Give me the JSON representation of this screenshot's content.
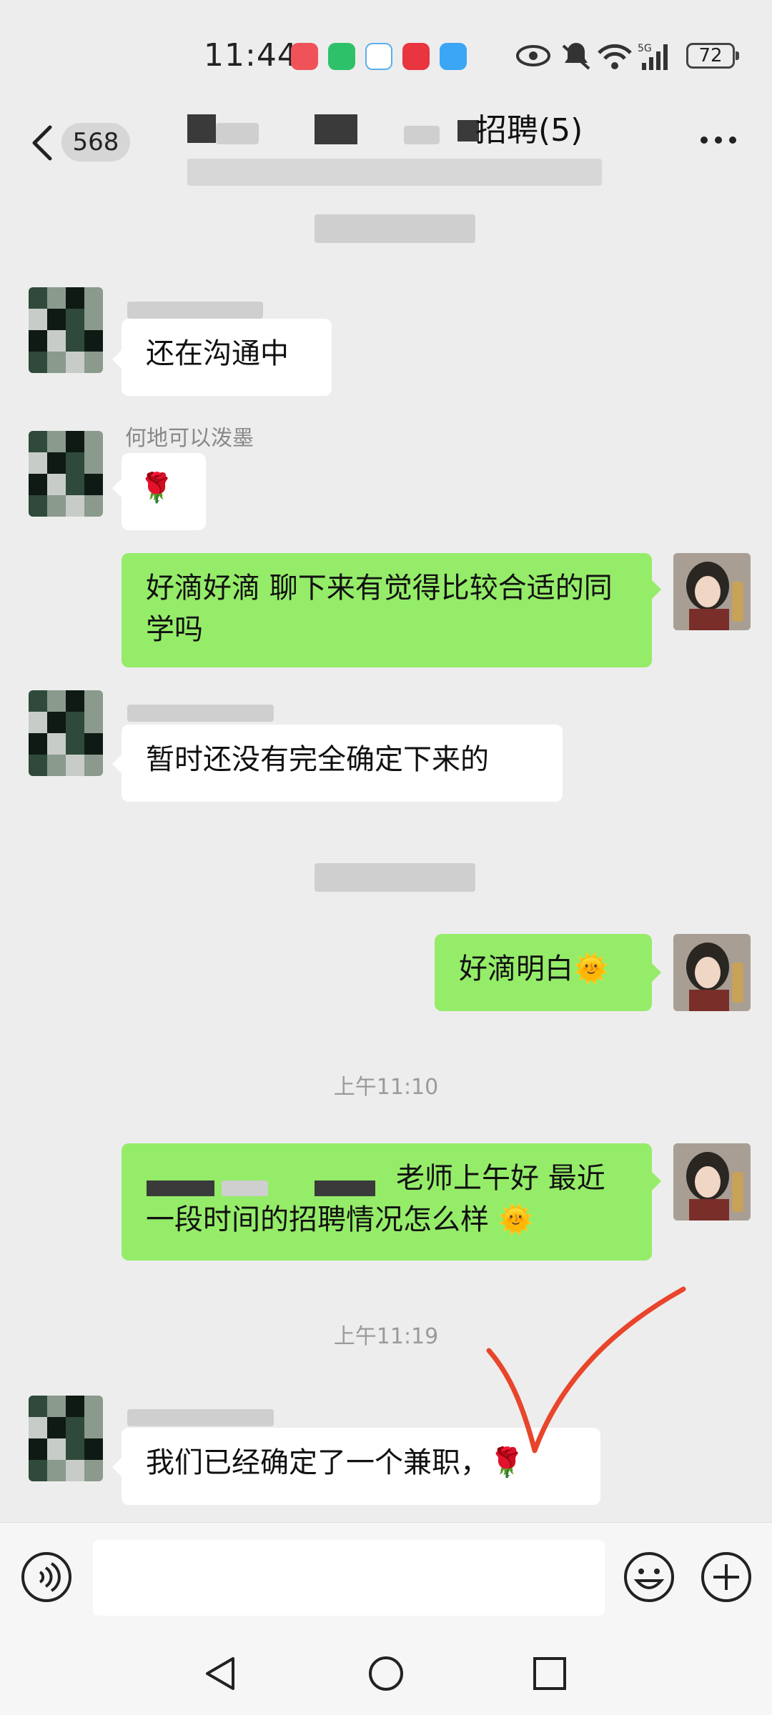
{
  "status_bar": {
    "time": "11:44",
    "network": "5G",
    "battery": "72"
  },
  "header": {
    "unread_count": "568",
    "title": "招聘(5)"
  },
  "messages": {
    "m1": "还在沟通中",
    "m2_sender": "何地可以泼墨",
    "m2": "🌹",
    "m3": "好滴好滴 聊下来有觉得比较合适的同学吗",
    "m4": "暂时还没有完全确定下来的",
    "m5": "好滴明白🌞",
    "ts1": "上午11:10",
    "m6": "老师上午好 最近一段时间的招聘情况怎么样 🌞",
    "ts2": "上午11:19",
    "m7": "我们已经确定了一个兼职，🌹"
  },
  "input": {
    "value": ""
  },
  "colors": {
    "bubble_out": "#95ec69",
    "bubble_in": "#ffffff",
    "annotation": "#e8452c"
  }
}
